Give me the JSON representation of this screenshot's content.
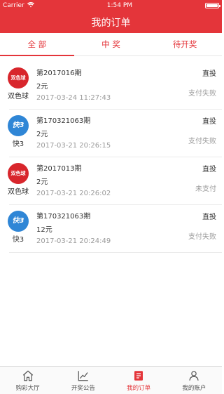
{
  "status_bar": {
    "carrier": "Carrier",
    "time": "1:54 PM",
    "battery_level": 1.0
  },
  "header": {
    "title": "我的订单"
  },
  "tabs": [
    {
      "label": "全 部",
      "active": true
    },
    {
      "label": "中 奖",
      "active": false
    },
    {
      "label": "待开奖",
      "active": false
    }
  ],
  "orders": [
    {
      "logo_text": "双色球",
      "logo_color": "#d8262c",
      "lottery": "双色球",
      "issue": "第2017016期",
      "amount": "2元",
      "time": "2017-03-24 11:27:43",
      "type": "直投",
      "status": "支付失败"
    },
    {
      "logo_text": "快3",
      "logo_color": "#2f86d6",
      "lottery": "快3",
      "issue": "第170321063期",
      "amount": "2元",
      "time": "2017-03-21 20:26:15",
      "type": "直投",
      "status": "支付失败"
    },
    {
      "logo_text": "双色球",
      "logo_color": "#d8262c",
      "lottery": "双色球",
      "issue": "第2017013期",
      "amount": "2元",
      "time": "2017-03-21 20:26:02",
      "type": "直投",
      "status": "未支付"
    },
    {
      "logo_text": "快3",
      "logo_color": "#2f86d6",
      "lottery": "快3",
      "issue": "第170321063期",
      "amount": "12元",
      "time": "2017-03-21 20:24:49",
      "type": "直投",
      "status": "支付失败"
    }
  ],
  "tabbar": [
    {
      "label": "购彩大厅",
      "icon": "home-icon"
    },
    {
      "label": "开奖公告",
      "icon": "chart-icon"
    },
    {
      "label": "我的订单",
      "icon": "orders-icon",
      "active": true
    },
    {
      "label": "我的账户",
      "icon": "user-icon"
    }
  ],
  "colors": {
    "brand_red": "#e4353a",
    "muted_text": "#9a9a9a"
  }
}
